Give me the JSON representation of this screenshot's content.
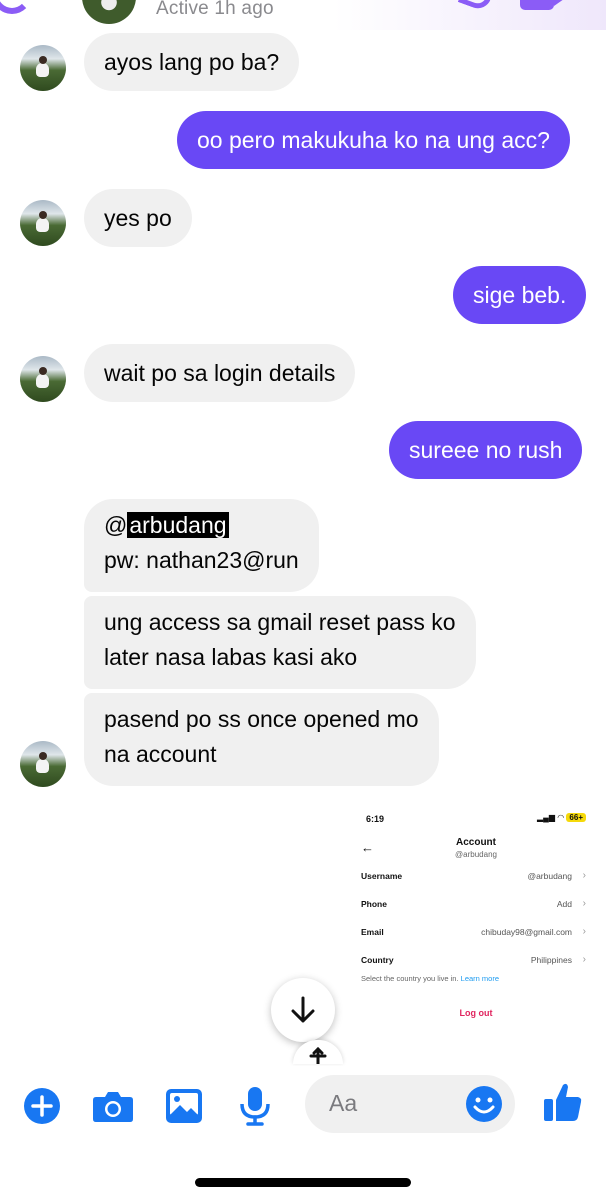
{
  "header": {
    "status": "Active 1h ago"
  },
  "messages": [
    {
      "dir": "in",
      "text": "ayos lang po ba?"
    },
    {
      "dir": "out",
      "text": "oo pero makukuha ko na ung acc?"
    },
    {
      "dir": "in",
      "text": "yes po"
    },
    {
      "dir": "out",
      "text": "sige beb."
    },
    {
      "dir": "in",
      "text": "wait po sa login details"
    },
    {
      "dir": "out",
      "text": "sureee no rush"
    },
    {
      "dir": "in",
      "lines": [
        "@",
        "arbudang",
        "pw: nathan23@run"
      ]
    },
    {
      "dir": "in",
      "lines": [
        "ung access sa gmail reset pass ko",
        "later nasa labas kasi ako"
      ]
    },
    {
      "dir": "in",
      "lines": [
        "pasend po ss once opened mo",
        "na account"
      ]
    }
  ],
  "screenshot": {
    "time": "6:19",
    "battery": "66+",
    "title": "Account",
    "handle": "@arbudang",
    "rows": [
      {
        "label": "Username",
        "value": "@arbudang"
      },
      {
        "label": "Phone",
        "value": "Add"
      },
      {
        "label": "Email",
        "value": "chibuday98@gmail.com"
      },
      {
        "label": "Country",
        "value": "Philippines"
      }
    ],
    "note": "Select the country you live in.",
    "note_link": "Learn more",
    "logout": "Log out"
  },
  "composer": {
    "placeholder": "Aa"
  },
  "colors": {
    "accent": "#6948f5",
    "icon_blue": "#1877f2",
    "incoming_bubble": "#f0f0f0"
  }
}
